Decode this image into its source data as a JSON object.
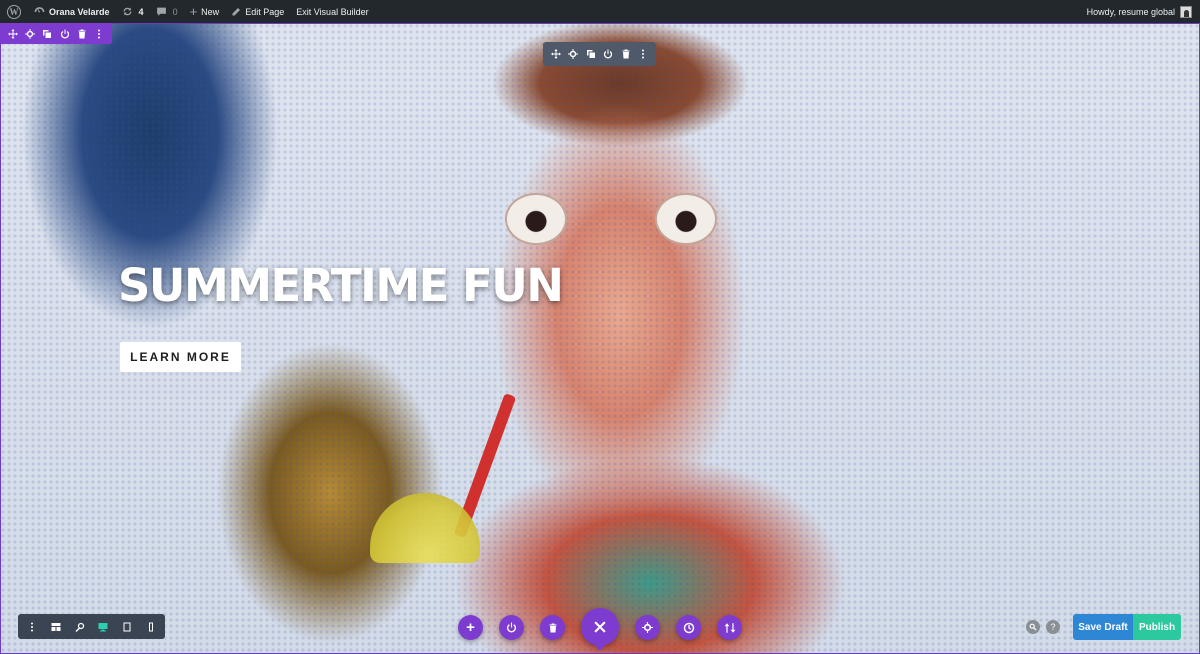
{
  "adminbar": {
    "site_name": "Orana Velarde",
    "updates_count": "4",
    "comments_count": "0",
    "new_label": "New",
    "edit_page_label": "Edit Page",
    "exit_builder_label": "Exit Visual Builder",
    "howdy_label": "Howdy, resume global"
  },
  "hero": {
    "title": "SUMMERTIME FUN",
    "button_label": "LEARN MORE"
  },
  "section_toolbar": {
    "icons": [
      "move-icon",
      "gear-icon",
      "duplicate-icon",
      "power-icon",
      "trash-icon",
      "more-icon"
    ]
  },
  "row_toolbar": {
    "icons": [
      "move-icon",
      "gear-icon",
      "duplicate-icon",
      "power-icon",
      "trash-icon",
      "more-icon"
    ]
  },
  "view_bar": {
    "icons": [
      "more-icon",
      "layout-icon",
      "zoom-icon",
      "desktop-icon",
      "tablet-icon",
      "phone-icon"
    ],
    "active": "desktop-icon"
  },
  "page_actions": {
    "icons": [
      "add-icon",
      "power-icon",
      "trash-icon",
      "close-icon",
      "gear-icon",
      "history-icon",
      "sort-icon"
    ]
  },
  "footer": {
    "save_draft_label": "Save Draft",
    "publish_label": "Publish"
  },
  "colors": {
    "divi_purple": "#7e3bd0",
    "row_gray": "#50596a",
    "save_blue": "#2e87d5",
    "publish_green": "#2bc99d"
  }
}
